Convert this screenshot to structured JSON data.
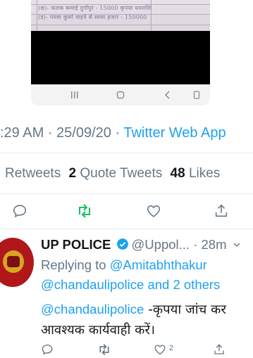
{
  "embedded_image": {
    "lines": [
      "(छ)-   फलक कमाई दुर्गापुर        - 15000 कृपया धनराशि",
      "(ड)-   पयवा कुवर्र वाहने से स्वसा हजार - 150000"
    ]
  },
  "tweet": {
    "time": ":29 AM",
    "separator": " · ",
    "date": "25/09/20",
    "source": "Twitter Web App"
  },
  "stats": {
    "retweets_label": "Retweets",
    "quote_count": "2",
    "quote_label": "Quote Tweets",
    "likes_count": "48",
    "likes_label": "Likes"
  },
  "reply": {
    "name": "UP POLICE",
    "handle": "@Uppol...",
    "dot": " · ",
    "age": "28m",
    "replying_prefix": "Replying to",
    "replying_user": "@Amitabhthakur",
    "replying_line2": "@chandaulipolice and 2 others",
    "body_mention": "@chandaulipolice",
    "body_text": " -कृपया जांच कर",
    "body_line2": "आवश्यक कार्यवाही करें।",
    "like_count": "2"
  },
  "colors": {
    "link": "#1da1f2",
    "muted": "#657786",
    "text": "#14171a",
    "retweet_green": "#17bf63"
  },
  "icons": [
    "reply-icon",
    "retweet-icon",
    "like-icon",
    "share-icon",
    "verified-badge-icon",
    "chevron-down-icon"
  ]
}
